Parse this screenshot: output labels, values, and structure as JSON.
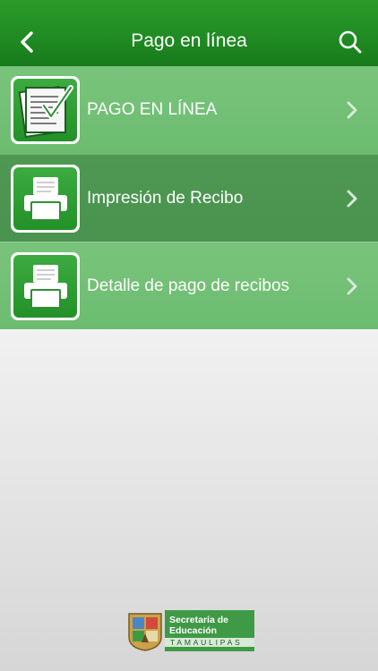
{
  "header": {
    "title": "Pago en línea",
    "back_icon": "chevron-left-icon",
    "search_icon": "search-icon"
  },
  "menu": {
    "items": [
      {
        "label": "PAGO EN LÍNEA",
        "icon": "checklist-document-icon",
        "selected": false
      },
      {
        "label": "Impresión de Recibo",
        "icon": "printer-icon",
        "selected": true
      },
      {
        "label": "Detalle de pago de recibos",
        "icon": "printer-icon",
        "selected": false
      }
    ]
  },
  "footer": {
    "logo_line1": "Secretaría de",
    "logo_line2": "Educación",
    "logo_line3": "TAMAULIPAS"
  },
  "colors": {
    "header": "#1f8a22",
    "row": "#6cbc70",
    "row_selected": "#4a9350"
  }
}
